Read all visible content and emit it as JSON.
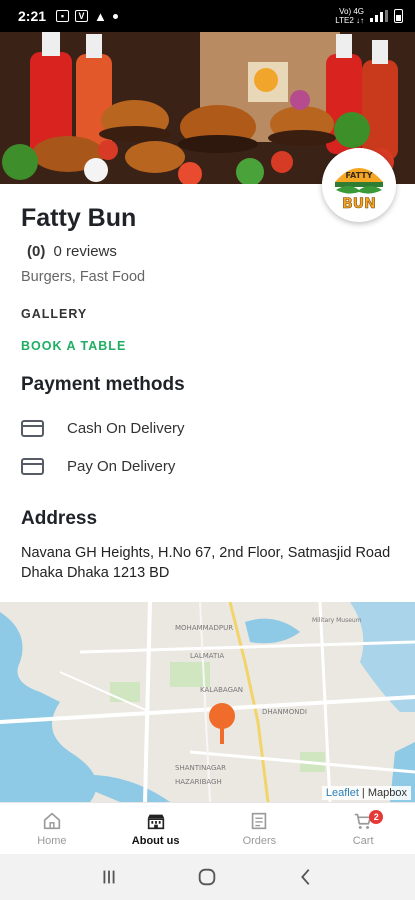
{
  "status_bar": {
    "time": "2:21",
    "network_top": "Vo) 4G",
    "network_bottom": "LTE2 ↓↑"
  },
  "restaurant": {
    "name": "Fatty Bun",
    "rating_count": "(0)",
    "reviews": "0 reviews",
    "cuisine": "Burgers, Fast Food",
    "logo_text_top": "FATTY",
    "logo_text_bottom": "BUN"
  },
  "links": {
    "gallery": "GALLERY",
    "book_table": "BOOK A TABLE"
  },
  "payment": {
    "heading": "Payment methods",
    "methods": [
      "Cash On Delivery",
      "Pay On Delivery"
    ]
  },
  "address": {
    "heading": "Address",
    "text": "Navana GH Heights, H.No 67, 2nd Floor, Satmasjid Road Dhaka Dhaka 1213 BD"
  },
  "map": {
    "attribution_leaflet": "Leaflet",
    "attribution_sep": " | ",
    "attribution_mapbox": "Mapbox",
    "labels": [
      "MOHAMMADPUR",
      "LALMATIA",
      "KALABAGAN",
      "DHANMONDI",
      "SHANTINAGAR",
      "HAZARIBAGH",
      "Military Museum"
    ]
  },
  "bottom_nav": {
    "items": [
      {
        "label": "Home",
        "icon": "home-icon",
        "active": false
      },
      {
        "label": "About us",
        "icon": "building-icon",
        "active": true
      },
      {
        "label": "Orders",
        "icon": "receipt-icon",
        "active": false
      },
      {
        "label": "Cart",
        "icon": "cart-icon",
        "active": false
      }
    ],
    "cart_badge": "2"
  },
  "colors": {
    "accent_green": "#1fae62",
    "badge_red": "#e53935",
    "map_pin": "#ef6c2a"
  }
}
